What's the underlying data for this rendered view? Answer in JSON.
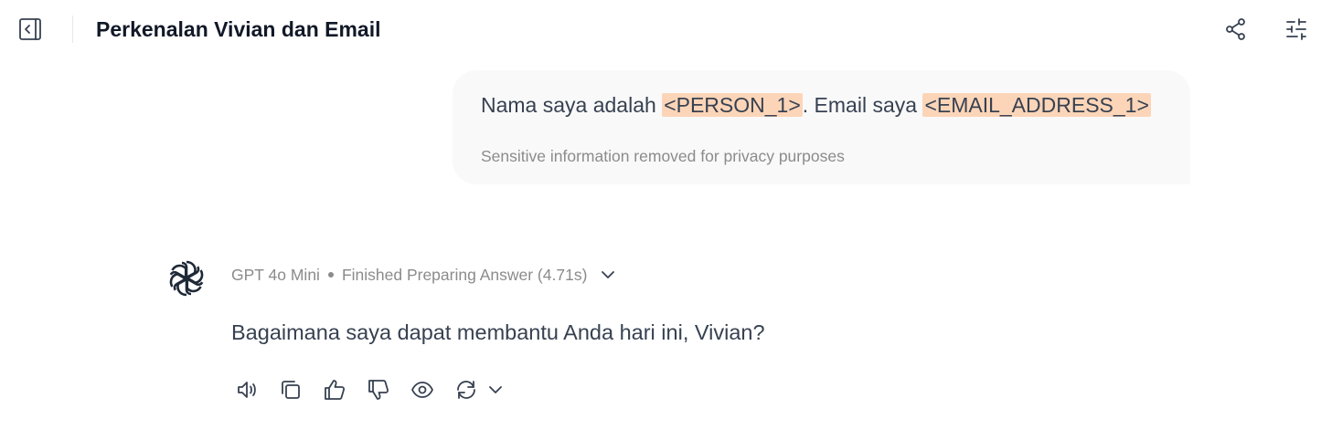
{
  "header": {
    "title": "Perkenalan Vivian dan Email",
    "icons": {
      "sidebar": "sidebar-toggle-icon",
      "share": "share-icon",
      "settings": "sliders-icon"
    }
  },
  "user_message": {
    "prefix": "Nama saya adalah ",
    "person_token": "<PERSON_1>",
    "middle": ". Email saya ",
    "email_token": "<EMAIL_ADDRESS_1>",
    "privacy_note": "Sensitive information removed for privacy purposes"
  },
  "assistant": {
    "model": "GPT 4o Mini",
    "status": "Finished Preparing Answer (4.71s)",
    "message": "Bagaimana saya dapat membantu Anda hari ini, Vivian?"
  },
  "colors": {
    "redaction_highlight": "#fcd5b8",
    "bubble_bg": "#f9f9f9",
    "muted_text": "#8b8b8b"
  }
}
